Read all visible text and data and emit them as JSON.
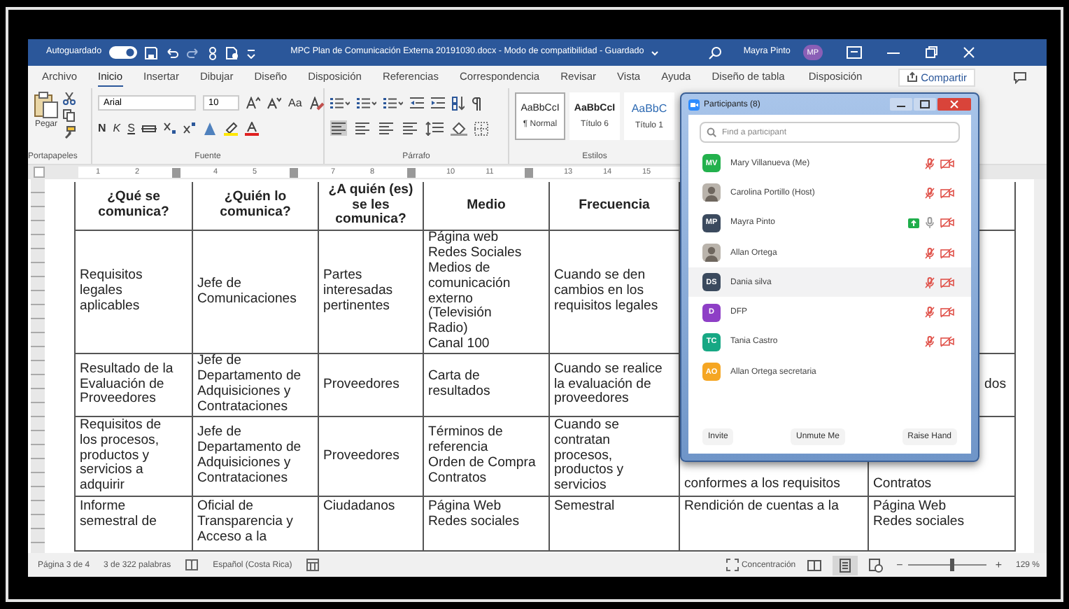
{
  "title_bar": {
    "autosave_label": "Autoguardado",
    "autosave_on": true,
    "document_title": "MPC Plan de Comunicación Externa 20191030.docx - Modo de compatibilidad - Guardado",
    "user_name": "Mayra Pinto",
    "user_initials": "MP"
  },
  "ribbon_tabs": [
    {
      "label": "Archivo",
      "selected": false
    },
    {
      "label": "Inicio",
      "selected": true
    },
    {
      "label": "Insertar",
      "selected": false
    },
    {
      "label": "Dibujar",
      "selected": false
    },
    {
      "label": "Diseño",
      "selected": false
    },
    {
      "label": "Disposición",
      "selected": false
    },
    {
      "label": "Referencias",
      "selected": false
    },
    {
      "label": "Correspondencia",
      "selected": false
    },
    {
      "label": "Revisar",
      "selected": false
    },
    {
      "label": "Vista",
      "selected": false
    },
    {
      "label": "Ayuda",
      "selected": false
    },
    {
      "label": "Diseño de tabla",
      "selected": false
    },
    {
      "label": "Disposición",
      "selected": false
    }
  ],
  "share_button": "Compartir",
  "ribbon": {
    "clipboard": {
      "paste_label": "Pegar",
      "group_label": "Portapapeles"
    },
    "font": {
      "name": "Arial",
      "size": "10",
      "change_case": "Aa",
      "bold": "N",
      "italic": "K",
      "underline": "S",
      "group_label": "Fuente"
    },
    "paragraph": {
      "group_label": "Párrafo"
    },
    "styles": {
      "group_label": "Estilos",
      "items": [
        {
          "preview": "AaBbCcI",
          "name": "¶ Normal",
          "kind": "normal",
          "selected": true
        },
        {
          "preview": "AaBbCcI",
          "name": "Título 6",
          "kind": "strong",
          "selected": false
        },
        {
          "preview": "AaBbC",
          "name": "Título 1",
          "kind": "heading",
          "selected": false
        }
      ]
    }
  },
  "ruler": [
    {
      "kind": "number",
      "label": "1"
    },
    {
      "kind": "number",
      "label": "2"
    },
    {
      "kind": "marker"
    },
    {
      "kind": "number",
      "label": "4"
    },
    {
      "kind": "number",
      "label": "5"
    },
    {
      "kind": "marker"
    },
    {
      "kind": "number",
      "label": "7"
    },
    {
      "kind": "number",
      "label": "8"
    },
    {
      "kind": "marker"
    },
    {
      "kind": "number",
      "label": "10"
    },
    {
      "kind": "number",
      "label": "11"
    },
    {
      "kind": "marker"
    },
    {
      "kind": "number",
      "label": "13"
    },
    {
      "kind": "number",
      "label": "14"
    },
    {
      "kind": "number",
      "label": "15"
    }
  ],
  "table": {
    "columns": [
      "¿Qué se\ncomunica?",
      "¿Quién lo\ncomunica?",
      "¿A quién (es)\nse les\ncomunica?",
      "Medio",
      "Frecuencia"
    ],
    "rows": [
      {
        "cells": [
          "Requisitos\nlegales\naplicables",
          "Jefe de\nComunicaciones",
          "Partes\ninteresadas\npertinentes",
          "Página web\nRedes Sociales\nMedios de\ncomunicación\nexterno\n(Televisión\nRadio)\nCanal 100",
          "Cuando se den\ncambios en los\nrequisitos legales"
        ]
      },
      {
        "cells": [
          "Resultado de la\nEvaluación de\nProveedores",
          "Jefe de\nDepartamento de\nAdquisiciones y\nContrataciones",
          "Proveedores",
          "Carta de\nresultados",
          "Cuando se realice\nla evaluación de\nproveedores"
        ],
        "column_7": {
          "text": "dos",
          "cut_left": true
        }
      },
      {
        "cells": [
          "Requisitos de\nlos procesos,\nproductos y\nservicios a\nadquirir",
          "Jefe de\nDepartamento de\nAdquisiciones y\nContrataciones",
          "Proveedores",
          "Términos de\nreferencia\nOrden de Compra\nContratos",
          "Cuando se\ncontratan\nprocesos,\nproductos y\nservicios"
        ],
        "column_6": {
          "text": "conformes a los requisitos",
          "cut_top": true
        },
        "column_7": {
          "text": "Contratos",
          "cut_top": true
        }
      },
      {
        "cells": [
          "Informe\nsemestral de",
          "Oficial de\nTransparencia y\nAcceso a la",
          "Ciudadanos",
          "Página Web\nRedes sociales",
          "Semestral"
        ],
        "column_6": {
          "text": "Rendición de cuentas a la"
        },
        "column_7": {
          "text": "Página Web\nRedes sociales"
        }
      }
    ]
  },
  "participants_panel": {
    "title": "Participants (8)",
    "search": {
      "placeholder": "Find a participant"
    },
    "participants": [
      {
        "kind": "initials",
        "initials": "MV",
        "color": "#23b14d",
        "name": "Mary Villanueva (Me)",
        "muted": true,
        "video_off": true,
        "sharing": false,
        "selected": false
      },
      {
        "kind": "photo",
        "name": "Carolina Portillo (Host)",
        "muted": true,
        "video_off": true,
        "sharing": false,
        "selected": false
      },
      {
        "kind": "initials",
        "initials": "MP",
        "color": "#3b4a5e",
        "name": "Mayra Pinto",
        "muted": false,
        "video_off": true,
        "sharing": true,
        "selected": false
      },
      {
        "kind": "photo",
        "name": "Allan Ortega",
        "muted": true,
        "video_off": true,
        "sharing": false,
        "selected": false
      },
      {
        "kind": "initials",
        "initials": "DS",
        "color": "#3b4a5e",
        "name": "Dania silva",
        "muted": true,
        "video_off": true,
        "sharing": false,
        "selected": true
      },
      {
        "kind": "initials",
        "initials": "D",
        "color": "#8e3fc6",
        "name": "DFP",
        "muted": true,
        "video_off": true,
        "sharing": false,
        "selected": false
      },
      {
        "kind": "initials",
        "initials": "TC",
        "color": "#17a884",
        "name": "Tania Castro",
        "muted": true,
        "video_off": true,
        "sharing": false,
        "selected": false
      },
      {
        "kind": "initials",
        "initials": "AO",
        "color": "#f5a623",
        "name": "Allan Ortega secretaria",
        "sharing": false,
        "selected": false
      }
    ],
    "buttons": [
      "Invite",
      "Unmute Me",
      "Raise Hand"
    ]
  },
  "status_bar": {
    "page": "Página 3 de 4",
    "words": "3 de 322 palabras",
    "language": "Español (Costa Rica)",
    "focus": "Concentración",
    "views": [
      {
        "kind": "read",
        "selected": false
      },
      {
        "kind": "print",
        "selected": true
      },
      {
        "kind": "web",
        "selected": false
      }
    ],
    "zoom_out": "−",
    "zoom_in": "+",
    "zoom": {
      "level": 0.55
    },
    "zoom_label": "129 %"
  }
}
